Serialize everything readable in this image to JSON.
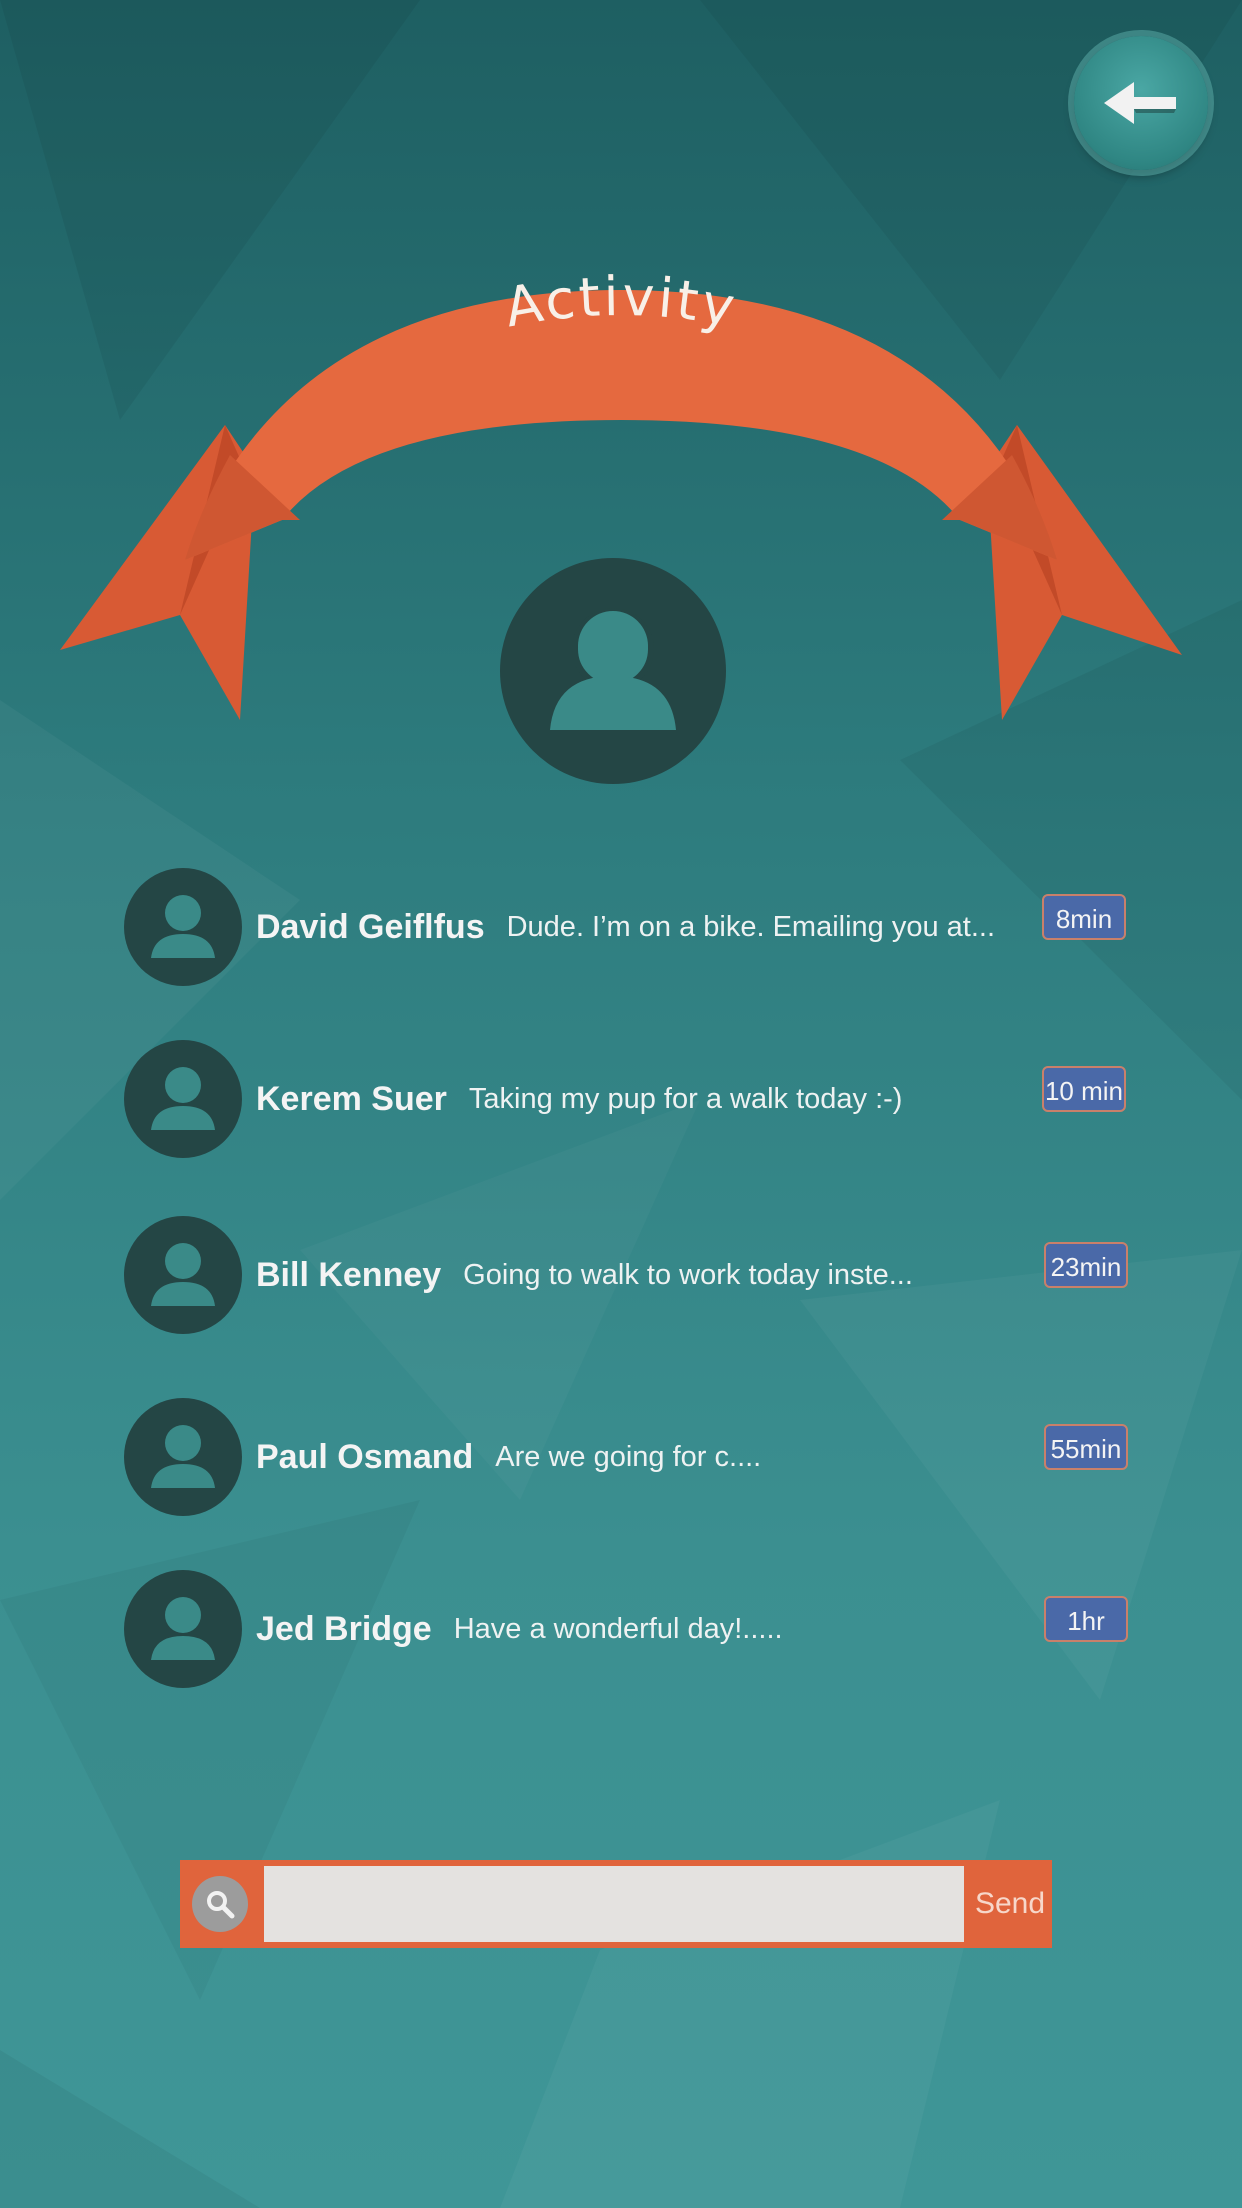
{
  "header": {
    "title": "Activity",
    "back_icon": "back-arrow-icon"
  },
  "colors": {
    "background": "#2d7b7d",
    "ribbon": "#e5693f",
    "avatar": "#244645",
    "badge": "#4a69a8",
    "composer": "#e0643c"
  },
  "activity": {
    "items": [
      {
        "name": "David Geiflfus",
        "message": "Dude. I’m on a bike. Emailing you at...",
        "time": "8min"
      },
      {
        "name": "Kerem Suer",
        "message": "Taking my pup for a walk today :-)",
        "time": "10 min"
      },
      {
        "name": "Bill Kenney",
        "message": "Going to walk to work today inste...",
        "time": "23min"
      },
      {
        "name": "Paul Osmand",
        "message": "Are we going for c....",
        "time": "55min"
      },
      {
        "name": "Jed Bridge",
        "message": "Have a wonderful day!.....",
        "time": "1hr"
      }
    ]
  },
  "composer": {
    "search_icon": "search-icon",
    "input_value": "",
    "placeholder": "",
    "send_label": "Send"
  }
}
